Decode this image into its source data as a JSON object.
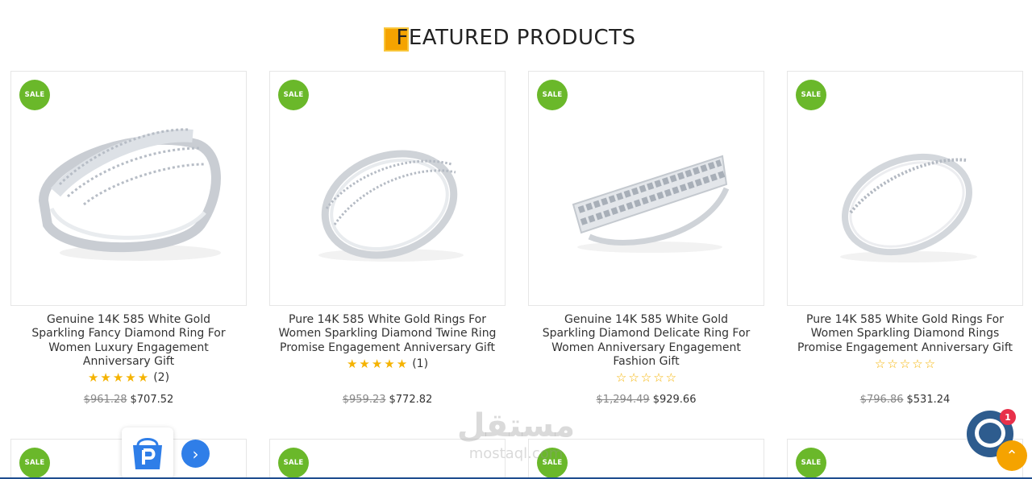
{
  "section": {
    "title": "FEATURED PRODUCTS"
  },
  "badge_label": "SALE",
  "products": [
    {
      "name": "Genuine 14K 585 White Gold Sparkling Fancy Diamond Ring For Women Luxury Engagement Anniversary Gift",
      "rating": 5,
      "review_count": "(2)",
      "old_price": "$961.28",
      "price": "$707.52"
    },
    {
      "name": "Pure 14K 585 White Gold Rings For Women Sparkling Diamond Twine Ring Promise Engagement Anniversary Gift",
      "rating": 5,
      "review_count": "(1)",
      "old_price": "$959.23",
      "price": "$772.82"
    },
    {
      "name": "Genuine 14K 585 White Gold Sparkling Diamond Delicate Ring For Women Anniversary Engagement Fashion Gift",
      "rating": 0,
      "review_count": "",
      "old_price": "$1,294.49",
      "price": "$929.66"
    },
    {
      "name": "Pure 14K 585 White Gold Rings For Women Sparkling Diamond Rings Promise Engagement Anniversary Gift",
      "rating": 0,
      "review_count": "",
      "old_price": "$796.86",
      "price": "$531.24"
    }
  ],
  "watermark": {
    "arabic": "مستقل",
    "latin": "mostaql.com"
  },
  "chat": {
    "unread_count": "1"
  },
  "icons": {
    "star_filled": "★",
    "star_empty": "☆",
    "next": "›",
    "scroll_top": "⌃"
  },
  "colors": {
    "sale_badge": "#6ab82a",
    "accent": "#f5a300",
    "star": "#f5b301",
    "chat": "#2e5c8e",
    "next_button": "#2f7ee8"
  }
}
